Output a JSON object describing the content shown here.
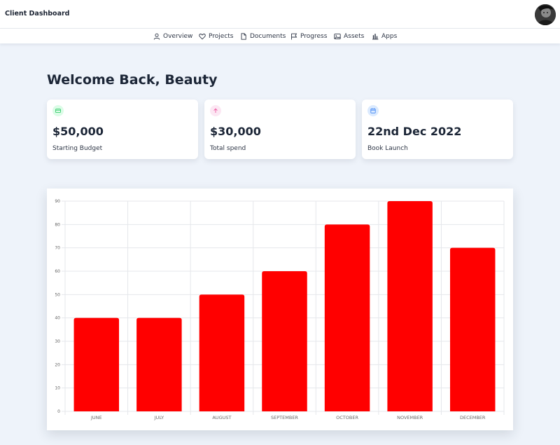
{
  "app": {
    "title": "Client Dashboard"
  },
  "user": {
    "avatar_icon": "user-avatar-photo"
  },
  "nav": [
    {
      "label": "Overview",
      "icon": "user-icon"
    },
    {
      "label": "Projects",
      "icon": "heart-icon"
    },
    {
      "label": "Documents",
      "icon": "document-icon"
    },
    {
      "label": "Progress",
      "icon": "flag-icon"
    },
    {
      "label": "Assets",
      "icon": "image-icon"
    },
    {
      "label": "Apps",
      "icon": "bar-chart-icon"
    }
  ],
  "welcome": "Welcome Back, Beauty",
  "cards": [
    {
      "value": "$50,000",
      "label": "Starting Budget",
      "icon": "wallet-icon",
      "color": "#22c55e",
      "bg": "#dcfce7"
    },
    {
      "value": "$30,000",
      "label": "Total spend",
      "icon": "arrow-up-icon",
      "color": "#ec4899",
      "bg": "#fce7f3"
    },
    {
      "value": "22nd Dec 2022",
      "label": "Book Launch",
      "icon": "calendar-icon",
      "color": "#3b82f6",
      "bg": "#dbeafe"
    }
  ],
  "chart_data": {
    "type": "bar",
    "categories": [
      "JUNE",
      "JULY",
      "AUGUST",
      "SEPTEMBER",
      "OCTOBER",
      "NOVEMBER",
      "DECEMBER"
    ],
    "values": [
      40,
      40,
      50,
      60,
      80,
      90,
      70
    ],
    "ylim": [
      0,
      90
    ],
    "yticks": [
      0,
      10,
      20,
      30,
      40,
      50,
      60,
      70,
      80,
      90
    ],
    "bar_color": "#ff0000",
    "grid": true,
    "title": "",
    "xlabel": "",
    "ylabel": ""
  }
}
